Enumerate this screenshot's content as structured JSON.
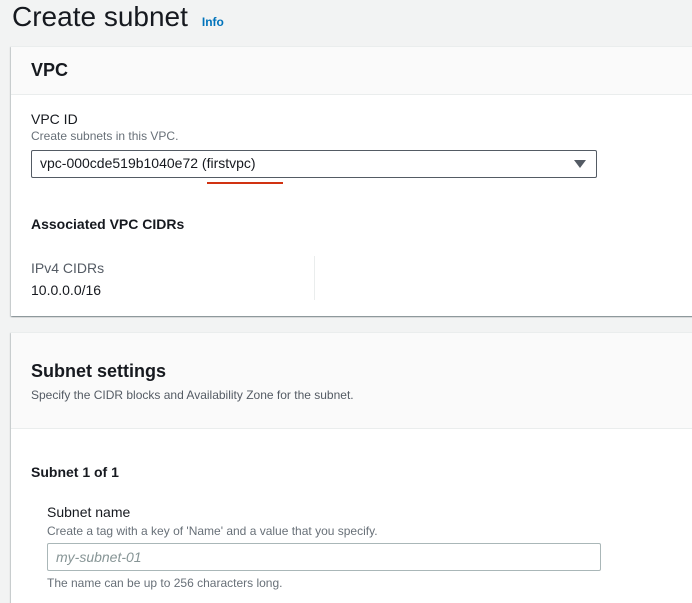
{
  "page": {
    "title": "Create subnet",
    "info_link": "Info"
  },
  "vpc_panel": {
    "title": "VPC",
    "vpc_id_label": "VPC ID",
    "vpc_id_description": "Create subnets in this VPC.",
    "vpc_id_selected": "vpc-000cde519b1040e72 (firstvpc)",
    "associated_title": "Associated VPC CIDRs",
    "ipv4_label": "IPv4 CIDRs",
    "ipv4_value": "10.0.0.0/16"
  },
  "subnet_panel": {
    "title": "Subnet settings",
    "description": "Specify the CIDR blocks and Availability Zone for the subnet.",
    "subnet_count": "Subnet 1 of 1",
    "name_label": "Subnet name",
    "name_description": "Create a tag with a key of 'Name' and a value that you specify.",
    "name_placeholder": "my-subnet-01",
    "name_value": "",
    "name_constraint": "The name can be up to 256 characters long."
  },
  "colors": {
    "link": "#0073bb",
    "annotation_underline": "#d13212",
    "background": "#f2f3f3"
  },
  "icons": {
    "select_caret": "caret-down-icon"
  }
}
